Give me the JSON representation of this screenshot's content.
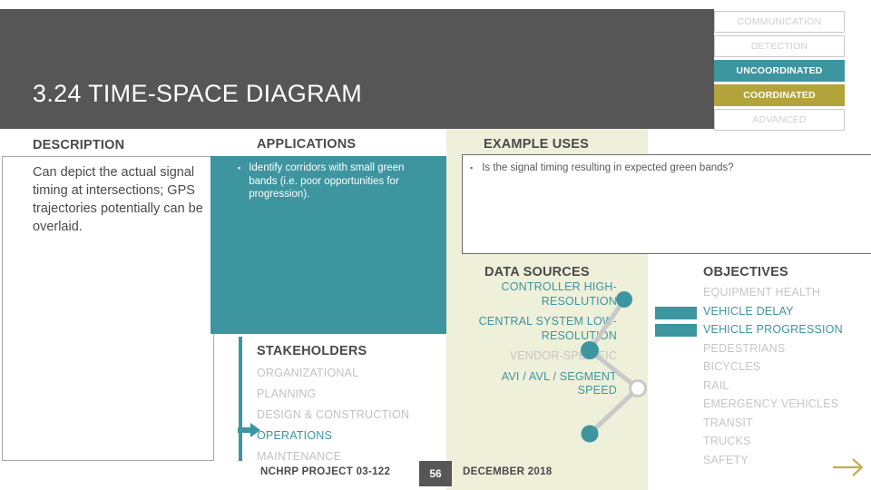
{
  "slide": {
    "title": "3.24 TIME-SPACE DIAGRAM"
  },
  "colors": {
    "teal": "#3d95a0",
    "gold": "#b3a33b",
    "header_gray": "#565656",
    "cream": "#eef0da",
    "muted_gray": "#c6c6c6"
  },
  "category_badges": [
    {
      "label": "COMMUNICATION",
      "state": "off"
    },
    {
      "label": "DETECTION",
      "state": "off"
    },
    {
      "label": "UNCOORDINATED",
      "state": "teal"
    },
    {
      "label": "COORDINATED",
      "state": "gold"
    },
    {
      "label": "ADVANCED",
      "state": "off"
    }
  ],
  "sections": {
    "description": {
      "heading": "DESCRIPTION",
      "body": "Can depict the actual signal timing at intersections; GPS trajectories potentially can be overlaid."
    },
    "applications": {
      "heading": "APPLICATIONS",
      "bullet_glyph": "▪",
      "items": [
        "Identify corridors with small green bands (i.e. poor opportunities for progression)."
      ]
    },
    "example_uses": {
      "heading": "EXAMPLE USES",
      "bullet_glyph": "▪",
      "items": [
        "Is the signal timing resulting in expected green bands?"
      ]
    },
    "stakeholders": {
      "heading": "STAKEHOLDERS",
      "items": [
        {
          "label": "ORGANIZATIONAL",
          "active": false
        },
        {
          "label": "PLANNING",
          "active": false
        },
        {
          "label": "DESIGN & CONSTRUCTION",
          "active": false
        },
        {
          "label": "OPERATIONS",
          "active": true
        },
        {
          "label": "MAINTENANCE",
          "active": false
        }
      ]
    },
    "data_sources": {
      "heading": "DATA SOURCES",
      "items": [
        {
          "label": "CONTROLLER HIGH-RESOLUTION",
          "active": true
        },
        {
          "label": "CENTRAL SYSTEM LOW-RESOLUTION",
          "active": true
        },
        {
          "label": "VENDOR-SPECIFIC",
          "active": false
        },
        {
          "label": "AVI / AVL / SEGMENT SPEED",
          "active": true
        }
      ]
    },
    "objectives": {
      "heading": "OBJECTIVES",
      "items": [
        {
          "label": "EQUIPMENT HEALTH",
          "active": false
        },
        {
          "label": "VEHICLE DELAY",
          "active": true
        },
        {
          "label": "VEHICLE PROGRESSION",
          "active": true
        },
        {
          "label": "PEDESTRIANS",
          "active": false
        },
        {
          "label": "BICYCLES",
          "active": false
        },
        {
          "label": "RAIL",
          "active": false
        },
        {
          "label": "EMERGENCY VEHICLES",
          "active": false
        },
        {
          "label": "TRANSIT",
          "active": false
        },
        {
          "label": "TRUCKS",
          "active": false
        },
        {
          "label": "SAFETY",
          "active": false
        }
      ]
    }
  },
  "footer": {
    "project": "NCHRP PROJECT 03-122",
    "page_number": "56",
    "date": "DECEMBER 2018"
  },
  "icons": {
    "stakeholder_pointer": "right-arrow-icon",
    "next_slide": "next-arrow-icon"
  }
}
